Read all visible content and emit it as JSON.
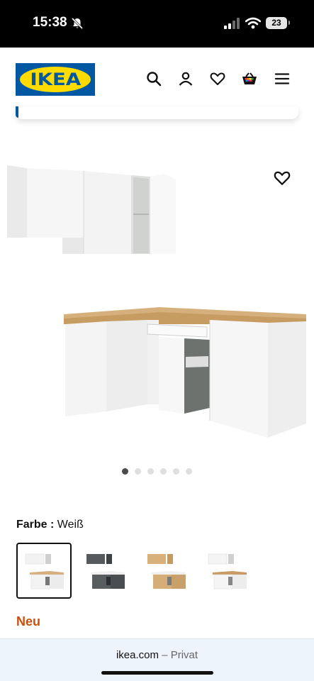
{
  "status_bar": {
    "time": "15:38",
    "battery": "23"
  },
  "header": {
    "logo_text": "IKEA",
    "icons": [
      "search-icon",
      "account-icon",
      "wishlist-icon",
      "cart-icon",
      "menu-icon"
    ]
  },
  "product": {
    "color_label": "Farbe :",
    "color_value": "Weiß",
    "gallery_count": 6,
    "gallery_active": 0,
    "variants": [
      "white-oak",
      "dark-grey",
      "oak",
      "white"
    ],
    "selected_variant": 0,
    "badge": "Neu"
  },
  "colors": {
    "ikea_blue": "#0058a3",
    "ikea_yellow": "#ffdb00",
    "new_badge": "#ca5008",
    "countertop": "#d6b07c"
  },
  "browser": {
    "domain": "ikea.com",
    "separator": " – ",
    "mode": "Privat"
  }
}
